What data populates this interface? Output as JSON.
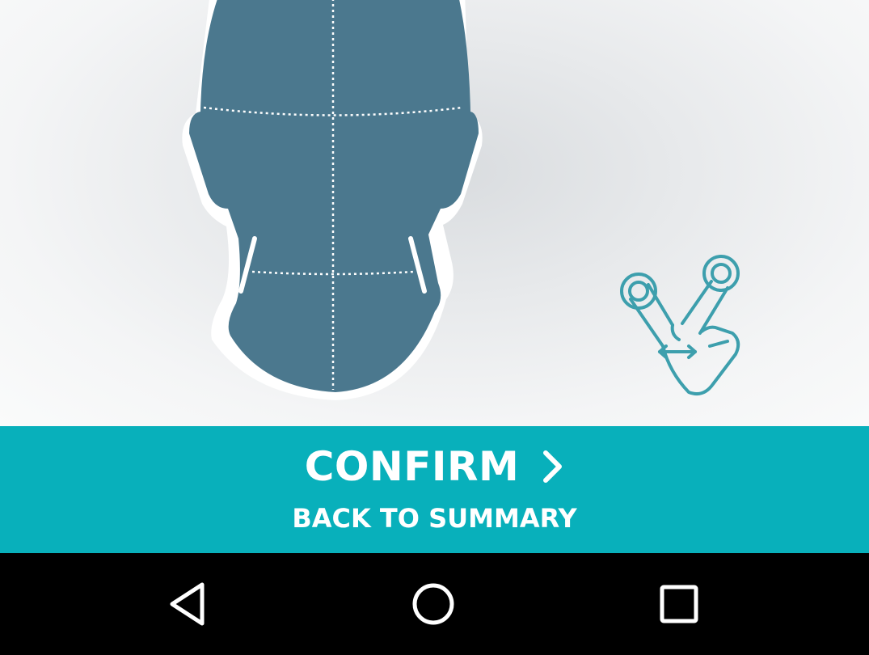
{
  "actions": {
    "confirm_label": "CONFIRM",
    "back_label": "BACK TO SUMMARY"
  },
  "icons": {
    "head": "head-front-view-icon",
    "gesture": "pinch-zoom-gesture-icon",
    "confirm_arrow": "chevron-right-icon",
    "nav_back": "back-triangle-icon",
    "nav_home": "home-circle-icon",
    "nav_recents": "recents-square-icon"
  },
  "colors": {
    "accent": "#08b0bb",
    "head_fill": "#4b788e",
    "gesture_stroke": "#3d9fad",
    "nav_bar": "#000000"
  }
}
